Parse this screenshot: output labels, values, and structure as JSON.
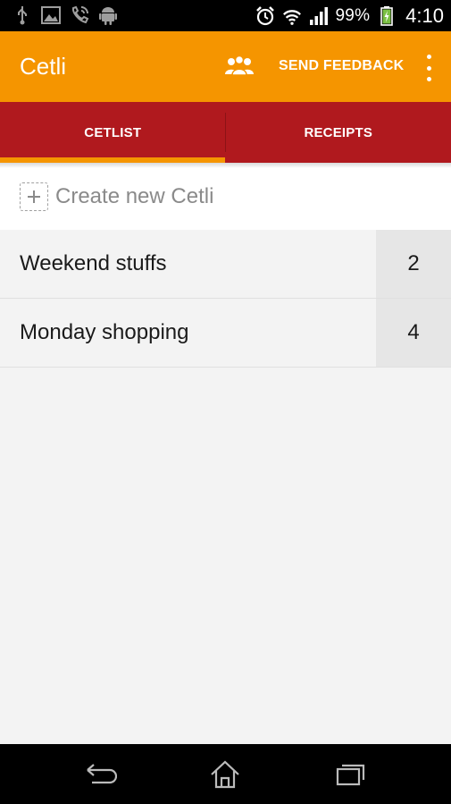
{
  "status_bar": {
    "battery": "99%",
    "time": "4:10",
    "icons": [
      "usb-icon",
      "image-icon",
      "phone-icon",
      "android-icon",
      "alarm-icon",
      "wifi-icon",
      "signal-icon",
      "battery-icon"
    ]
  },
  "action_bar": {
    "title": "Cetli",
    "people_icon": "people-icon",
    "send_feedback": "SEND FEEDBACK",
    "overflow_icon": "overflow-menu-icon",
    "background": "#f59500"
  },
  "tabs": {
    "items": [
      {
        "label": "CETLIST",
        "selected": true
      },
      {
        "label": "RECEIPTS",
        "selected": false
      }
    ],
    "background": "#b0191e",
    "indicator": "#f59500"
  },
  "create": {
    "label": "Create new Cetli",
    "icon": "add-icon"
  },
  "lists": [
    {
      "name": "Weekend stuffs",
      "count": "2"
    },
    {
      "name": "Monday shopping",
      "count": "4"
    }
  ],
  "nav_bar": {
    "icons": [
      "back-icon",
      "home-icon",
      "recents-icon"
    ]
  }
}
